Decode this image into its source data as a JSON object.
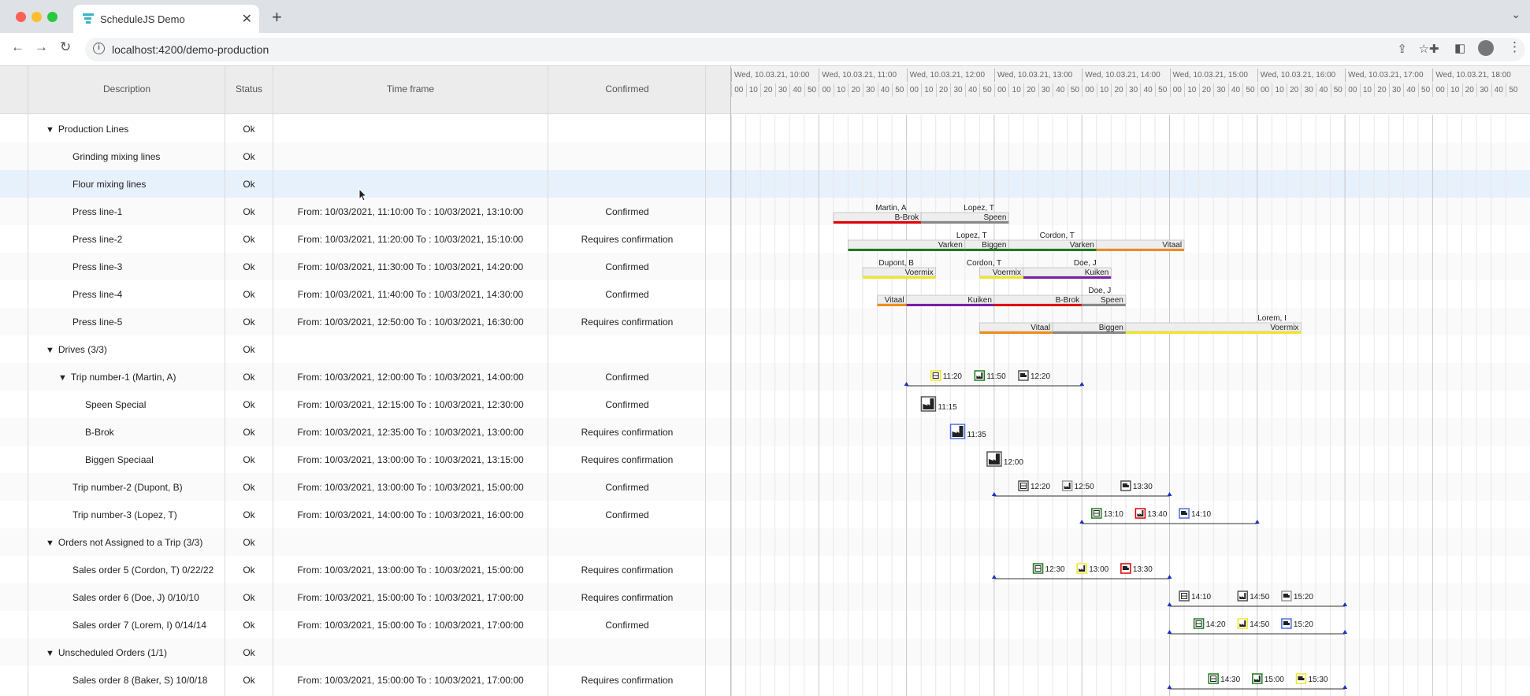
{
  "browser": {
    "tab_title": "ScheduleJS Demo",
    "url": "localhost:4200/demo-production",
    "colors": {
      "logo": "#3bb3c3"
    }
  },
  "columns": {
    "description": "Description",
    "status": "Status",
    "timeframe": "Time frame",
    "confirmed": "Confirmed"
  },
  "timeline": {
    "hours": [
      "Wed, 10.03.21, 10:00",
      "Wed, 10.03.21, 11:00",
      "Wed, 10.03.21, 12:00",
      "Wed, 10.03.21, 13:00",
      "Wed, 10.03.21, 14:00",
      "Wed, 10.03.21, 15:00",
      "Wed, 10.03.21, 16:00",
      "Wed, 10.03.21, 17:00",
      "Wed, 10.03.21, 18:00"
    ],
    "minutes": [
      "00",
      "10",
      "20",
      "30",
      "40",
      "50"
    ]
  },
  "rows": [
    {
      "desc": "Production Lines",
      "indent": 0,
      "toggle": "▼",
      "status": "Ok",
      "time": "",
      "conf": ""
    },
    {
      "desc": "Grinding mixing lines",
      "indent": 1,
      "toggle": "",
      "status": "Ok",
      "time": "",
      "conf": ""
    },
    {
      "desc": "Flour mixing lines",
      "indent": 1,
      "toggle": "",
      "status": "Ok",
      "time": "",
      "conf": "",
      "selected": true
    },
    {
      "desc": "Press line-1",
      "indent": 1,
      "toggle": "",
      "status": "Ok",
      "time": "From: 10/03/2021, 11:10:00 To : 10/03/2021, 13:10:00",
      "conf": "Confirmed"
    },
    {
      "desc": "Press line-2",
      "indent": 1,
      "toggle": "",
      "status": "Ok",
      "time": "From: 10/03/2021, 11:20:00 To : 10/03/2021, 15:10:00",
      "conf": "Requires confirmation"
    },
    {
      "desc": "Press line-3",
      "indent": 1,
      "toggle": "",
      "status": "Ok",
      "time": "From: 10/03/2021, 11:30:00 To : 10/03/2021, 14:20:00",
      "conf": "Confirmed"
    },
    {
      "desc": "Press line-4",
      "indent": 1,
      "toggle": "",
      "status": "Ok",
      "time": "From: 10/03/2021, 11:40:00 To : 10/03/2021, 14:30:00",
      "conf": "Confirmed"
    },
    {
      "desc": "Press line-5",
      "indent": 1,
      "toggle": "",
      "status": "Ok",
      "time": "From: 10/03/2021, 12:50:00 To : 10/03/2021, 16:30:00",
      "conf": "Requires confirmation"
    },
    {
      "desc": "Drives (3/3)",
      "indent": 0,
      "toggle": "▼",
      "status": "Ok",
      "time": "",
      "conf": ""
    },
    {
      "desc": "Trip number-1 (Martin, A)",
      "indent": 1,
      "toggle": "▼",
      "status": "Ok",
      "time": "From: 10/03/2021, 12:00:00 To : 10/03/2021, 14:00:00",
      "conf": "Confirmed"
    },
    {
      "desc": "Speen Special",
      "indent": 2,
      "toggle": "",
      "status": "Ok",
      "time": "From: 10/03/2021, 12:15:00 To : 10/03/2021, 12:30:00",
      "conf": "Confirmed"
    },
    {
      "desc": "B-Brok",
      "indent": 2,
      "toggle": "",
      "status": "Ok",
      "time": "From: 10/03/2021, 12:35:00 To : 10/03/2021, 13:00:00",
      "conf": "Requires confirmation"
    },
    {
      "desc": "Biggen Speciaal",
      "indent": 2,
      "toggle": "",
      "status": "Ok",
      "time": "From: 10/03/2021, 13:00:00 To : 10/03/2021, 13:15:00",
      "conf": "Requires confirmation"
    },
    {
      "desc": "Trip number-2 (Dupont, B)",
      "indent": 1,
      "toggle": "",
      "status": "Ok",
      "time": "From: 10/03/2021, 13:00:00 To : 10/03/2021, 15:00:00",
      "conf": "Confirmed"
    },
    {
      "desc": "Trip number-3 (Lopez, T)",
      "indent": 1,
      "toggle": "",
      "status": "Ok",
      "time": "From: 10/03/2021, 14:00:00 To : 10/03/2021, 16:00:00",
      "conf": "Confirmed"
    },
    {
      "desc": "Orders not Assigned to a Trip (3/3)",
      "indent": 0,
      "toggle": "▼",
      "status": "Ok",
      "time": "",
      "conf": ""
    },
    {
      "desc": "Sales order 5 (Cordon, T) 0/22/22",
      "indent": 1,
      "toggle": "",
      "status": "Ok",
      "time": "From: 10/03/2021, 13:00:00 To : 10/03/2021, 15:00:00",
      "conf": "Requires confirmation"
    },
    {
      "desc": "Sales order 6 (Doe, J) 0/10/10",
      "indent": 1,
      "toggle": "",
      "status": "Ok",
      "time": "From: 10/03/2021, 15:00:00 To : 10/03/2021, 17:00:00",
      "conf": "Requires confirmation"
    },
    {
      "desc": "Sales order 7 (Lorem, I) 0/14/14",
      "indent": 1,
      "toggle": "",
      "status": "Ok",
      "time": "From: 10/03/2021, 15:00:00 To : 10/03/2021, 17:00:00",
      "conf": "Confirmed"
    },
    {
      "desc": "Unscheduled Orders (1/1)",
      "indent": 0,
      "toggle": "▼",
      "status": "Ok",
      "time": "",
      "conf": ""
    },
    {
      "desc": "Sales order 8 (Baker, S) 10/0/18",
      "indent": 1,
      "toggle": "",
      "status": "Ok",
      "time": "From: 10/03/2021, 15:00:00 To : 10/03/2021, 17:00:00",
      "conf": "Requires confirmation"
    }
  ],
  "bars": [
    {
      "row": 3,
      "segs": [
        {
          "s": "11:10",
          "e": "12:10",
          "label": "B-Brok",
          "color": "#e00000"
        },
        {
          "s": "12:10",
          "e": "13:10",
          "label": "Speen",
          "color": "#888888"
        }
      ],
      "tops": [
        {
          "at": "12:00",
          "text": "Martin, A"
        },
        {
          "at": "13:00",
          "text": "Lopez, T"
        }
      ]
    },
    {
      "row": 4,
      "segs": [
        {
          "s": "11:20",
          "e": "12:40",
          "label": "Varken",
          "color": "#1e7b1e"
        },
        {
          "s": "12:40",
          "e": "13:10",
          "label": "Biggen",
          "color": "#1e7b1e"
        },
        {
          "s": "13:10",
          "e": "14:10",
          "label": "Varken",
          "color": "#1e7b1e"
        },
        {
          "s": "14:10",
          "e": "15:10",
          "label": "Vitaal",
          "color": "#f08c1e"
        }
      ],
      "tops": [
        {
          "at": "12:55",
          "text": "Lopez, T"
        },
        {
          "at": "13:55",
          "text": "Cordon, T"
        }
      ]
    },
    {
      "row": 5,
      "segs": [
        {
          "s": "11:30",
          "e": "12:20",
          "label": "Voermix",
          "color": "#f0e628"
        },
        {
          "s": "12:50",
          "e": "13:20",
          "label": "Voermix",
          "color": "#f0e628"
        },
        {
          "s": "13:20",
          "e": "14:20",
          "label": "Kuiken",
          "color": "#7a1fa2"
        }
      ],
      "tops": [
        {
          "at": "12:05",
          "text": "Dupont, B"
        },
        {
          "at": "13:05",
          "text": "Cordon, T"
        },
        {
          "at": "14:10",
          "text": "Doe, J"
        }
      ]
    },
    {
      "row": 6,
      "segs": [
        {
          "s": "11:40",
          "e": "12:00",
          "label": "Vitaal",
          "color": "#f08c1e"
        },
        {
          "s": "12:00",
          "e": "13:00",
          "label": "Kuiken",
          "color": "#7a1fa2"
        },
        {
          "s": "13:00",
          "e": "14:00",
          "label": "B-Brok",
          "color": "#e00000"
        },
        {
          "s": "14:00",
          "e": "14:30",
          "label": "Speen",
          "color": "#888888"
        }
      ],
      "tops": [
        {
          "at": "14:20",
          "text": "Doe, J"
        }
      ]
    },
    {
      "row": 7,
      "segs": [
        {
          "s": "12:50",
          "e": "13:40",
          "label": "Vitaal",
          "color": "#f08c1e"
        },
        {
          "s": "13:40",
          "e": "14:30",
          "label": "Biggen",
          "color": "#888888"
        },
        {
          "s": "14:30",
          "e": "16:30",
          "label": "Voermix",
          "color": "#f0e628"
        }
      ],
      "tops": [
        {
          "at": "16:20",
          "text": "Lorem, I"
        }
      ]
    }
  ],
  "trips": [
    {
      "row": 9,
      "s": "12:00",
      "e": "14:00"
    },
    {
      "row": 13,
      "s": "13:00",
      "e": "15:00"
    },
    {
      "row": 14,
      "s": "14:00",
      "e": "16:00"
    },
    {
      "row": 16,
      "s": "13:00",
      "e": "15:00"
    },
    {
      "row": 17,
      "s": "15:00",
      "e": "17:00"
    },
    {
      "row": 18,
      "s": "15:00",
      "e": "17:00"
    },
    {
      "row": 20,
      "s": "15:00",
      "e": "17:00"
    }
  ],
  "icons": [
    {
      "row": 9,
      "at": "12:20",
      "kind": "box",
      "color": "#f0e628",
      "label": "11:20"
    },
    {
      "row": 9,
      "at": "12:50",
      "kind": "factory",
      "color": "#1e7b1e",
      "label": "11:50"
    },
    {
      "row": 9,
      "at": "13:20",
      "kind": "truck",
      "color": "#555555",
      "label": "12:20"
    },
    {
      "row": 10,
      "at": "12:15",
      "kind": "factory",
      "color": "#555555",
      "label": "11:15",
      "big": true
    },
    {
      "row": 11,
      "at": "12:35",
      "kind": "factory",
      "color": "#4a6fe0",
      "label": "11:35",
      "big": true
    },
    {
      "row": 12,
      "at": "13:00",
      "kind": "factory",
      "color": "#555555",
      "label": "12:00",
      "big": true
    },
    {
      "row": 13,
      "at": "13:20",
      "kind": "box",
      "color": "#555555",
      "label": "12:20"
    },
    {
      "row": 13,
      "at": "13:50",
      "kind": "factory",
      "color": "#ffffff",
      "label": "12:50"
    },
    {
      "row": 13,
      "at": "14:30",
      "kind": "truck",
      "color": "#555555",
      "label": "13:30"
    },
    {
      "row": 14,
      "at": "14:10",
      "kind": "box",
      "color": "#1e7b1e",
      "label": "13:10"
    },
    {
      "row": 14,
      "at": "14:40",
      "kind": "factory",
      "color": "#e00000",
      "label": "13:40"
    },
    {
      "row": 14,
      "at": "15:10",
      "kind": "truck",
      "color": "#4a6fe0",
      "label": "14:10"
    },
    {
      "row": 16,
      "at": "13:30",
      "kind": "box",
      "color": "#1e7b1e",
      "label": "12:30"
    },
    {
      "row": 16,
      "at": "14:00",
      "kind": "factory",
      "color": "#f0e628",
      "label": "13:00"
    },
    {
      "row": 16,
      "at": "14:30",
      "kind": "truck",
      "color": "#e00000",
      "label": "13:30"
    },
    {
      "row": 17,
      "at": "15:10",
      "kind": "box",
      "color": "#555555",
      "label": "14:10"
    },
    {
      "row": 17,
      "at": "15:50",
      "kind": "factory",
      "color": "#555555",
      "label": "14:50"
    },
    {
      "row": 17,
      "at": "16:20",
      "kind": "truck",
      "color": "#ffffff",
      "label": "15:20"
    },
    {
      "row": 18,
      "at": "15:20",
      "kind": "box",
      "color": "#1e7b1e",
      "label": "14:20"
    },
    {
      "row": 18,
      "at": "15:50",
      "kind": "factory",
      "color": "#f0e628",
      "label": "14:50"
    },
    {
      "row": 18,
      "at": "16:20",
      "kind": "truck",
      "color": "#4a6fe0",
      "label": "15:20"
    },
    {
      "row": 20,
      "at": "15:30",
      "kind": "box",
      "color": "#1e7b1e",
      "label": "14:30"
    },
    {
      "row": 20,
      "at": "16:00",
      "kind": "factory",
      "color": "#1e7b1e",
      "label": "15:00"
    },
    {
      "row": 20,
      "at": "16:30",
      "kind": "truck",
      "color": "#f0e628",
      "label": "15:30"
    }
  ]
}
